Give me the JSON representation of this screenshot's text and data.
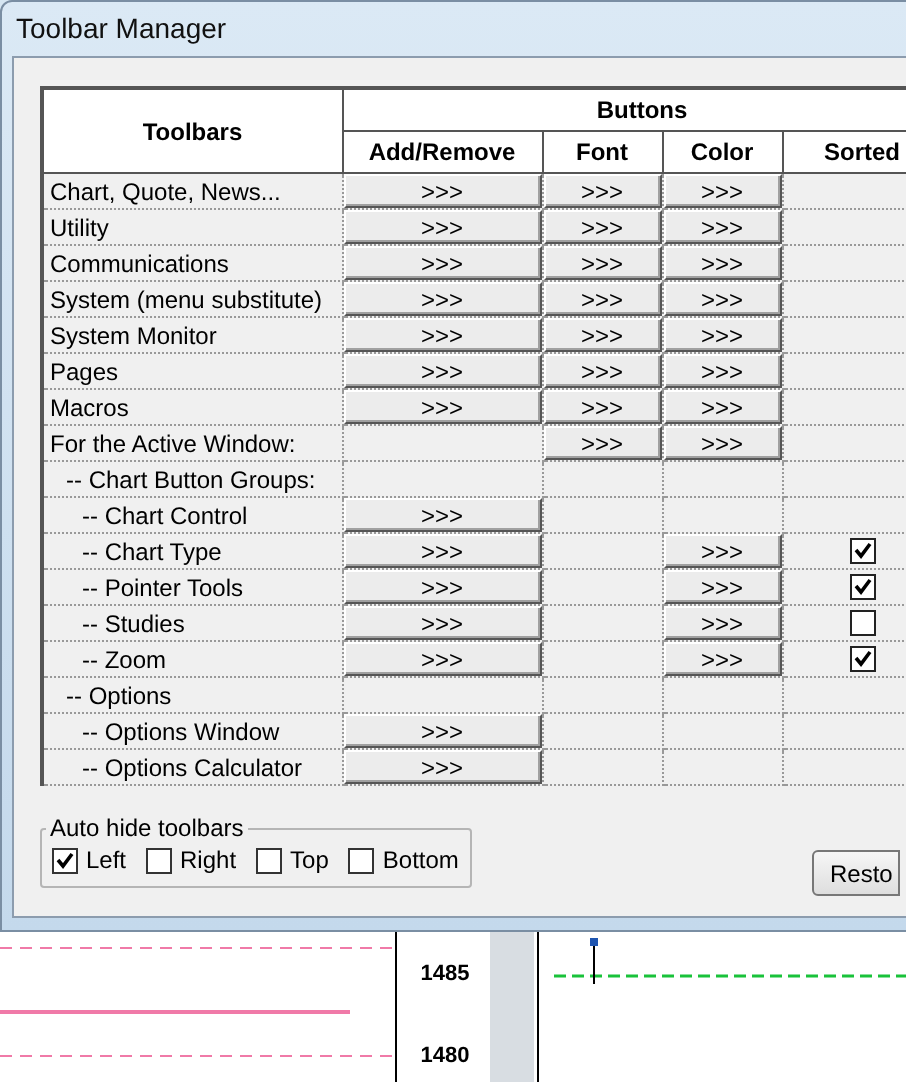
{
  "window": {
    "title": "Toolbar Manager"
  },
  "table": {
    "columns": {
      "toolbars": "Toolbars",
      "group": "Buttons",
      "add_remove": "Add/Remove",
      "font": "Font",
      "color_header": "Color",
      "sorted": "Sorted"
    },
    "rows": [
      {
        "label": "Chart, Quote, News...",
        "add_remove": ">>>",
        "font": ">>>",
        "color_button": ">>>"
      },
      {
        "label": "Utility",
        "add_remove": ">>>",
        "font": ">>>",
        "color_button": ">>>"
      },
      {
        "label": "Communications",
        "add_remove": ">>>",
        "font": ">>>",
        "color_button": ">>>"
      },
      {
        "label": "System (menu substitute)",
        "add_remove": ">>>",
        "font": ">>>",
        "color_button": ">>>"
      },
      {
        "label": "System Monitor",
        "add_remove": ">>>",
        "font": ">>>",
        "color_button": ">>>"
      },
      {
        "label": "Pages",
        "add_remove": ">>>",
        "font": ">>>",
        "color_button": ">>>"
      },
      {
        "label": "Macros",
        "add_remove": ">>>",
        "font": ">>>",
        "color_button": ">>>"
      },
      {
        "label": "For the Active Window:",
        "font": ">>>",
        "color_button": ">>>",
        "children": [
          {
            "label": "-- Chart Button Groups:",
            "children": [
              {
                "label": "-- Chart Control",
                "add_remove": ">>>"
              },
              {
                "label": "-- Chart Type",
                "add_remove": ">>>",
                "color_button": ">>>",
                "sorted": true
              },
              {
                "label": "-- Pointer Tools",
                "add_remove": ">>>",
                "color_button": ">>>",
                "sorted": true
              },
              {
                "label": "-- Studies",
                "add_remove": ">>>",
                "color_button": ">>>",
                "sorted": false
              },
              {
                "label": "-- Zoom",
                "add_remove": ">>>",
                "color_button": ">>>",
                "sorted": true
              }
            ]
          },
          {
            "label": "-- Options",
            "children": [
              {
                "label": "-- Options Window",
                "add_remove": ">>>"
              },
              {
                "label": "-- Options Calculator",
                "add_remove": ">>>"
              }
            ]
          }
        ]
      }
    ]
  },
  "auto_hide": {
    "title": "Auto hide toolbars",
    "options": [
      {
        "label": "Left",
        "checked": true
      },
      {
        "label": "Right",
        "checked": false
      },
      {
        "label": "Top",
        "checked": false
      },
      {
        "label": "Bottom",
        "checked": false
      }
    ]
  },
  "restore_button": "Resto",
  "background_chart": {
    "axis_labels": [
      "1485",
      "1480"
    ]
  }
}
